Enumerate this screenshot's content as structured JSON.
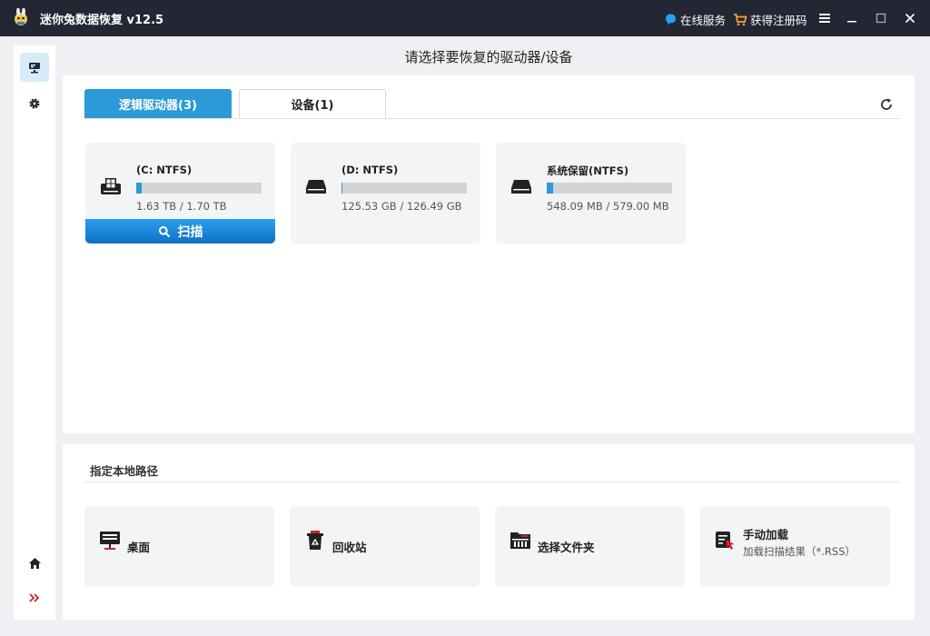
{
  "titlebar": {
    "title": "迷你兔数据恢复 v12.5",
    "online_service": "在线服务",
    "get_code": "获得注册码"
  },
  "sidebar": {
    "items": [
      {
        "icon": "drive-icon",
        "active": true
      },
      {
        "icon": "gear-icon",
        "active": false
      },
      {
        "icon": "home-icon",
        "active": false
      },
      {
        "icon": "double-chevron-icon",
        "active": false
      }
    ]
  },
  "page": {
    "heading": "请选择要恢复的驱动器/设备"
  },
  "tabs": [
    {
      "label": "逻辑驱动器(3)",
      "active": true
    },
    {
      "label": "设备(1)",
      "active": false
    }
  ],
  "drives": [
    {
      "name": "(C: NTFS)",
      "size": "1.63 TB / 1.70 TB",
      "used_fraction": 0.04,
      "icon": "windows-drive-icon",
      "selected": true,
      "scan_label": "扫描"
    },
    {
      "name": "(D: NTFS)",
      "size": "125.53 GB / 126.49 GB",
      "used_fraction": 0.01,
      "icon": "hard-drive-icon"
    },
    {
      "name": "系统保留(NTFS)",
      "size": "548.09 MB / 579.00 MB",
      "used_fraction": 0.05,
      "icon": "hard-drive-icon"
    }
  ],
  "local_path": {
    "heading": "指定本地路径",
    "items": [
      {
        "label": "桌面",
        "icon": "desktop-icon"
      },
      {
        "label": "回收站",
        "icon": "recycle-bin-icon"
      },
      {
        "label": "选择文件夹",
        "icon": "folder-icon"
      },
      {
        "label": "手动加载",
        "sub": "加载扫描结果（*.RSS）",
        "icon": "manual-load-icon"
      }
    ]
  },
  "colors": {
    "accent": "#2b9ad6",
    "titlebar_bg": "#222733",
    "service_icon": "#1ea4f0",
    "cart_icon": "#f2a33a",
    "load_icon_red": "#e02020"
  }
}
